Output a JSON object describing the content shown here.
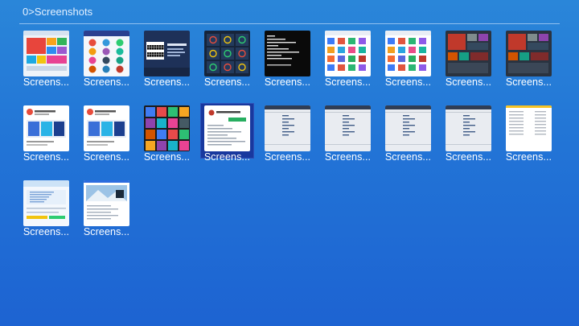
{
  "path": "0>Screenshots",
  "item_label": "Screens...",
  "items": [
    {
      "kind": "tiles-light"
    },
    {
      "kind": "apps-icons"
    },
    {
      "kind": "qr-dark"
    },
    {
      "kind": "dark-grid"
    },
    {
      "kind": "terminal"
    },
    {
      "kind": "apps-white"
    },
    {
      "kind": "apps-white2"
    },
    {
      "kind": "tiles-dark"
    },
    {
      "kind": "tiles-dark2"
    },
    {
      "kind": "web-page"
    },
    {
      "kind": "web-page2"
    },
    {
      "kind": "dark-collage"
    },
    {
      "kind": "doc-selected"
    },
    {
      "kind": "file-list"
    },
    {
      "kind": "file-list"
    },
    {
      "kind": "file-list"
    },
    {
      "kind": "file-list"
    },
    {
      "kind": "yellow-doc"
    },
    {
      "kind": "light-web"
    },
    {
      "kind": "photo-web"
    }
  ],
  "selected_index": 12
}
